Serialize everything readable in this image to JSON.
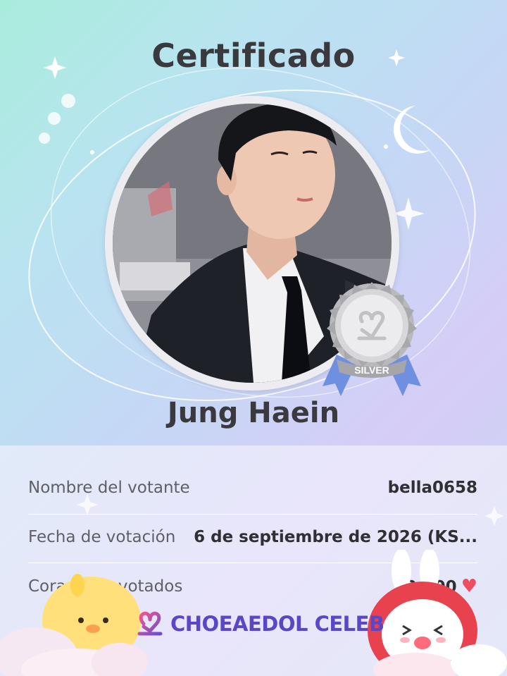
{
  "certificate": {
    "title": "Certificado",
    "celebrity_name": "Jung Haein",
    "badge": {
      "level": "SILVER",
      "color": "#c9c9cc"
    }
  },
  "details": {
    "voter": {
      "label": "Nombre del votante",
      "value": "bella0658"
    },
    "date": {
      "label": "Fecha de votación",
      "value": "6 de septiembre de 2026 (KS..."
    },
    "hearts": {
      "label": "Corazones votados",
      "value": "2.500",
      "icon": "heart-icon",
      "color": "#ee4d5e"
    }
  },
  "brand": {
    "name": "CHOEAEDOL CELEB",
    "logo_icon": "heart-logo-icon",
    "color": "#5a47c8"
  },
  "icons": [
    "sparkle-icon",
    "crescent-moon-icon",
    "star-icon",
    "orbit-ring"
  ]
}
